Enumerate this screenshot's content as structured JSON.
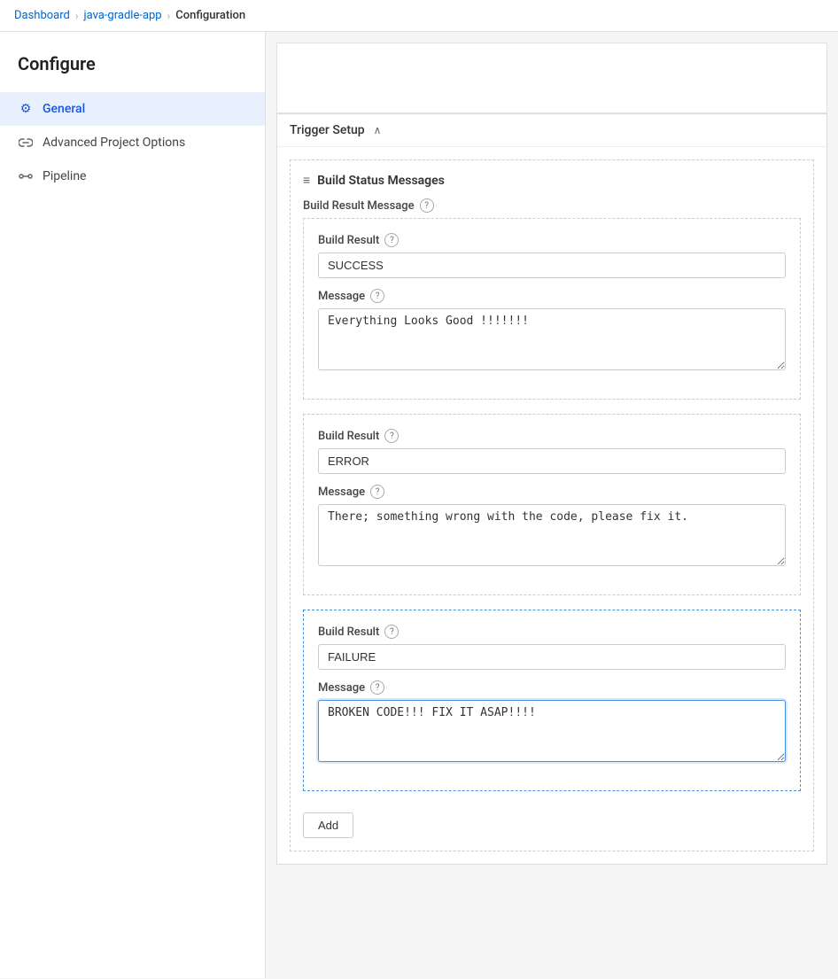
{
  "breadcrumb": {
    "items": [
      {
        "label": "Dashboard",
        "active": false
      },
      {
        "label": "java-gradle-app",
        "active": false
      },
      {
        "label": "Configuration",
        "active": true
      }
    ]
  },
  "sidebar": {
    "title": "Configure",
    "items": [
      {
        "id": "general",
        "label": "General",
        "icon": "gear",
        "active": true
      },
      {
        "id": "advanced",
        "label": "Advanced Project Options",
        "icon": "link",
        "active": false
      },
      {
        "id": "pipeline",
        "label": "Pipeline",
        "icon": "pipeline",
        "active": false
      }
    ]
  },
  "main": {
    "trigger_setup_label": "Trigger Setup",
    "trigger_setup_inner_label": "Trigger Setup",
    "build_status_messages_label": "Build Status Messages",
    "build_result_message_label": "Build Result Message",
    "build_result_label": "Build Result",
    "message_label": "Message",
    "add_button_label": "Add",
    "entries": [
      {
        "build_result_value": "SUCCESS",
        "message_value": "Everything Looks Good !!!!!!!",
        "active": false
      },
      {
        "build_result_value": "ERROR",
        "message_value": "There; something wrong with the code, please fix it.",
        "active": false
      },
      {
        "build_result_value": "FAILURE",
        "message_value": "BROKEN CODE!!! FIX IT ASAP!!!!",
        "active": true
      }
    ]
  },
  "icons": {
    "gear": "⚙",
    "link": "🔗",
    "pipeline": "↔",
    "chevron_right": "›",
    "chevron_down": "∨",
    "menu_lines": "≡",
    "help": "?"
  }
}
